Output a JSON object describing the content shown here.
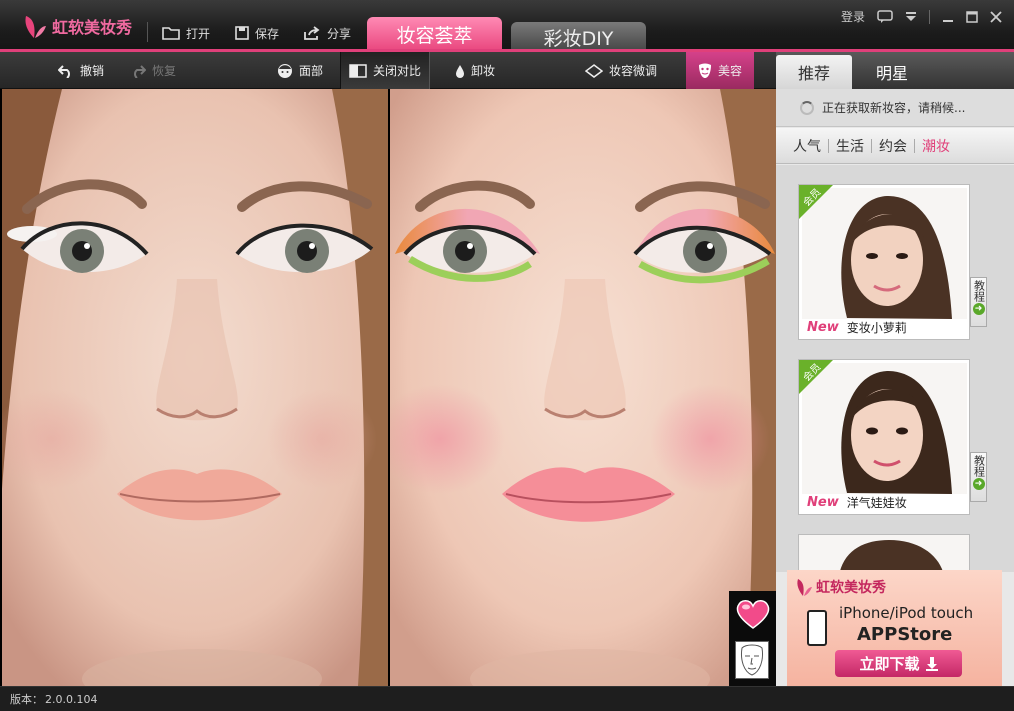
{
  "app": {
    "title": "虹软美妆秀",
    "brand_color": "#e0407a"
  },
  "titlebar": {
    "open_label": "打开",
    "save_label": "保存",
    "share_label": "分享",
    "tabs": [
      {
        "label": "妆容荟萃",
        "active": true
      },
      {
        "label": "彩妆DIY",
        "active": false
      }
    ],
    "login_label": "登录"
  },
  "toolbar": {
    "undo_label": "撤销",
    "redo_label": "恢复",
    "face_label": "面部",
    "compare_label": "关闭对比",
    "remove_makeup_label": "卸妆",
    "adjust_label": "妆容微调",
    "beauty_label": "美容"
  },
  "panel": {
    "tabs": [
      {
        "label": "推荐",
        "active": true
      },
      {
        "label": "明星",
        "active": false
      }
    ],
    "loading_text": "正在获取新妆容，请稍候...",
    "categories": [
      {
        "label": "人气",
        "active": false
      },
      {
        "label": "生活",
        "active": false
      },
      {
        "label": "约会",
        "active": false
      },
      {
        "label": "潮妆",
        "active": true
      }
    ],
    "looks": [
      {
        "badge": "会员",
        "new_tag": "New",
        "name": "变妆小萝莉",
        "tutorial": "教程"
      },
      {
        "badge": "会员",
        "new_tag": "New",
        "name": "洋气娃娃妆",
        "tutorial": "教程"
      }
    ],
    "ad": {
      "logo_text": "虹软美妆秀",
      "line1": "iPhone/iPod touch",
      "line2": "APPStore",
      "button": "立即下载"
    }
  },
  "status": {
    "version_label": "版本：",
    "version": "2.0.0.104"
  },
  "icons": [
    "butterfly-logo-icon",
    "folder-icon",
    "save-icon",
    "share-icon",
    "chat-icon",
    "dropdown-icon",
    "minimize-icon",
    "maximize-icon",
    "close-icon",
    "undo-icon",
    "redo-icon",
    "face-icon",
    "compare-icon",
    "drop-icon",
    "diamond-icon",
    "mask-icon",
    "heart-icon",
    "face-map-icon",
    "phone-icon",
    "download-arrow-icon"
  ]
}
